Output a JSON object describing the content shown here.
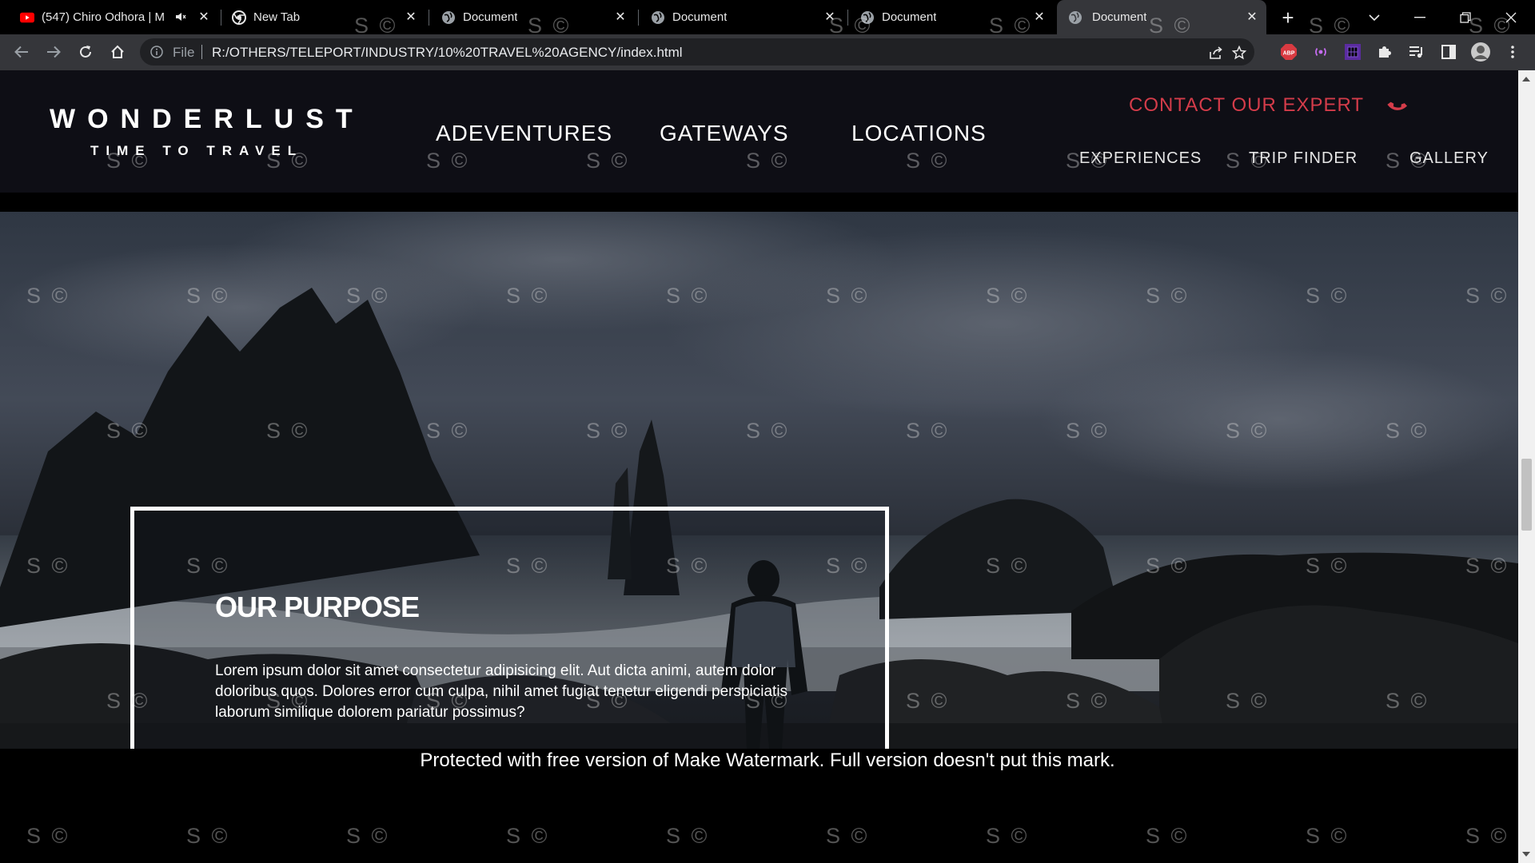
{
  "browser": {
    "tabs": [
      {
        "title": "(547) Chiro Odhora | M",
        "favicon": "youtube-icon",
        "muted_icon": "speaker-icon"
      },
      {
        "title": "New Tab",
        "favicon": "chrome-icon"
      },
      {
        "title": "Document",
        "favicon": "globe-icon"
      },
      {
        "title": "Document",
        "favicon": "globe-icon"
      },
      {
        "title": "Document",
        "favicon": "globe-icon"
      },
      {
        "title": "Document",
        "favicon": "globe-icon",
        "active": true
      }
    ],
    "close_glyph": "✕",
    "new_tab_glyph": "+",
    "omnibox": {
      "scheme_label": "File",
      "url": "R:/OTHERS/TELEPORT/INDUSTRY/10%20TRAVEL%20AGENCY/index.html"
    },
    "extensions": [
      "adblock-icon",
      "radio-extension-icon",
      "purple-square-extension-icon",
      "puzzle-icon",
      "media-queue-icon",
      "side-panel-icon",
      "profile-avatar-icon",
      "more-vert-icon"
    ]
  },
  "site": {
    "logo": {
      "name": "WONDERLUST",
      "tagline": "TIME TO TRAVEL"
    },
    "nav_main": [
      "ADEVENTURES",
      "GATEWAYS",
      "LOCATIONS"
    ],
    "contact_label": "CONTACT OUR EXPERT",
    "nav_secondary": [
      "EXPERIENCES",
      "TRIP FINDER",
      "GALLERY"
    ],
    "accent_color": "#d43c4a",
    "purpose": {
      "title": "OUR PURPOSE",
      "text": "Lorem ipsum dolor sit amet consectetur adipisicing elit. Aut dicta animi, autem dolor doloribus quos. Dolores error cum culpa, nihil amet fugiat tenetur eligendi perspiciatis laborum similique dolorem pariatur possimus?"
    }
  },
  "watermark": {
    "mark": "S ©",
    "notice": "Protected with free version of Make Watermark. Full version doesn't put this mark."
  }
}
